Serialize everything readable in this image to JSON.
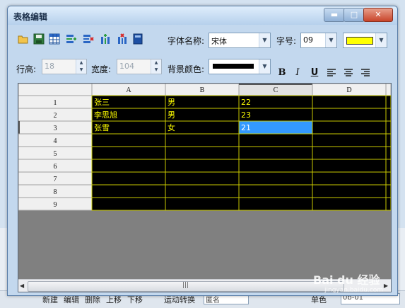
{
  "window": {
    "title": "表格编辑",
    "controls": {
      "minimize": "▬",
      "maximize": "□",
      "close": "✕"
    }
  },
  "toolbar": {
    "icons": [
      "open-folder-icon",
      "save-icon",
      "table-icon",
      "insert-row-icon",
      "delete-row-icon",
      "insert-column-icon",
      "delete-column-icon",
      "book-icon"
    ],
    "font_name_label": "字体名称:",
    "font_name_value": "宋体",
    "font_size_label": "字号:",
    "font_size_value": "09",
    "font_color": "#ffff00"
  },
  "format": {
    "row_height_label": "行高:",
    "row_height_value": "18",
    "width_label": "宽度:",
    "width_value": "104",
    "bg_color_label": "背景颜色:",
    "bg_color": "#000000",
    "bold": "B",
    "italic": "I",
    "underline": "U"
  },
  "table": {
    "columns": [
      "A",
      "B",
      "C",
      "D"
    ],
    "selected_column": "C",
    "row_numbers": [
      "1",
      "2",
      "3",
      "4",
      "5",
      "6",
      "7",
      "8",
      "9"
    ],
    "current_row": "3",
    "rows": [
      [
        "张三",
        "男",
        "22",
        ""
      ],
      [
        "李思旭",
        "男",
        "23",
        ""
      ],
      [
        "张雪",
        "女",
        "21",
        ""
      ],
      [
        "",
        "",
        "",
        ""
      ],
      [
        "",
        "",
        "",
        ""
      ],
      [
        "",
        "",
        "",
        ""
      ],
      [
        "",
        "",
        "",
        ""
      ],
      [
        "",
        "",
        "",
        ""
      ],
      [
        "",
        "",
        "",
        ""
      ]
    ],
    "selected_cell": {
      "row": 3,
      "column": "C"
    },
    "cell_text_color": "#ffff00",
    "cell_bg": "#000000",
    "grid_line_color": "#c8c800"
  },
  "background_app": {
    "buttons": [
      "新建",
      "编辑",
      "删除",
      "上移",
      "下移"
    ],
    "dropdown_label": "运动转换",
    "dropdown_value": "匿名",
    "radio_label": "单色",
    "field_value": "0b-01"
  },
  "watermark": {
    "logo": "Bai du 经验",
    "url": "jingyan.baidu.com"
  },
  "colors": {
    "titlebar": "#b6d0ec",
    "window_bg": "#c3d8ee",
    "grid_area": "#808080",
    "selection": "#3399ff"
  }
}
